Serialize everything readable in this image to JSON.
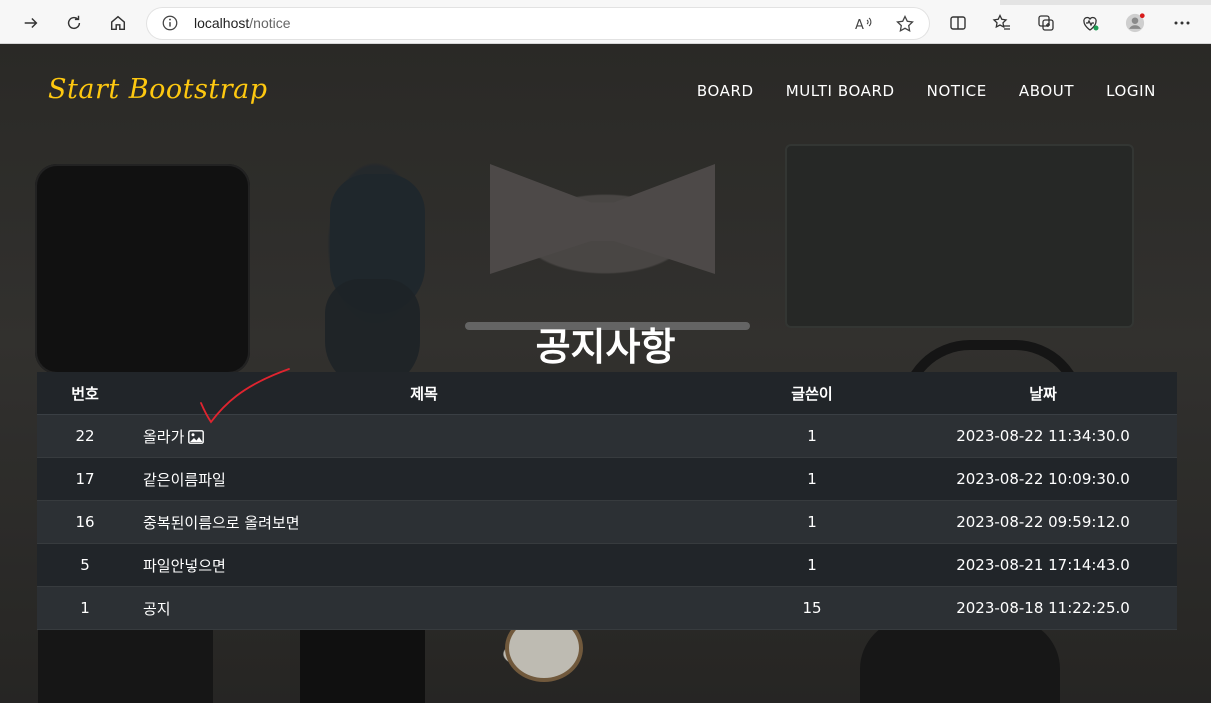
{
  "browser": {
    "url_host": "localhost",
    "url_path": "/notice"
  },
  "nav": {
    "brand": "Start Bootstrap",
    "items": [
      {
        "label": "BOARD"
      },
      {
        "label": "MULTI BOARD"
      },
      {
        "label": "NOTICE"
      },
      {
        "label": "ABOUT"
      },
      {
        "label": "LOGIN"
      }
    ]
  },
  "heading": "공지사항",
  "table": {
    "headers": [
      "번호",
      "제목",
      "글쓴이",
      "날짜"
    ],
    "rows": [
      {
        "no": "22",
        "title": "올라가",
        "has_image": true,
        "writer": "1",
        "date": "2023-08-22 11:34:30.0"
      },
      {
        "no": "17",
        "title": "같은이름파일",
        "writer": "1",
        "date": "2023-08-22 10:09:30.0"
      },
      {
        "no": "16",
        "title": "중복된이름으로 올려보면",
        "writer": "1",
        "date": "2023-08-22 09:59:12.0"
      },
      {
        "no": "5",
        "title": "파일안넣으면",
        "writer": "1",
        "date": "2023-08-21 17:14:43.0"
      },
      {
        "no": "1",
        "title": "공지",
        "writer": "15",
        "date": "2023-08-18 11:22:25.0"
      }
    ]
  },
  "colors": {
    "brand": "#fec810",
    "table_dark": "#212529",
    "table_stripe": "#2c3034",
    "annotation": "#e0242f"
  },
  "icons": [
    "forward-icon",
    "refresh-icon",
    "home-icon",
    "info-icon",
    "read-aloud-icon",
    "favorite-icon",
    "split-screen-icon",
    "favorites-list-icon",
    "collections-icon",
    "browser-essentials-icon",
    "profile-icon",
    "more-icon",
    "image-icon"
  ]
}
